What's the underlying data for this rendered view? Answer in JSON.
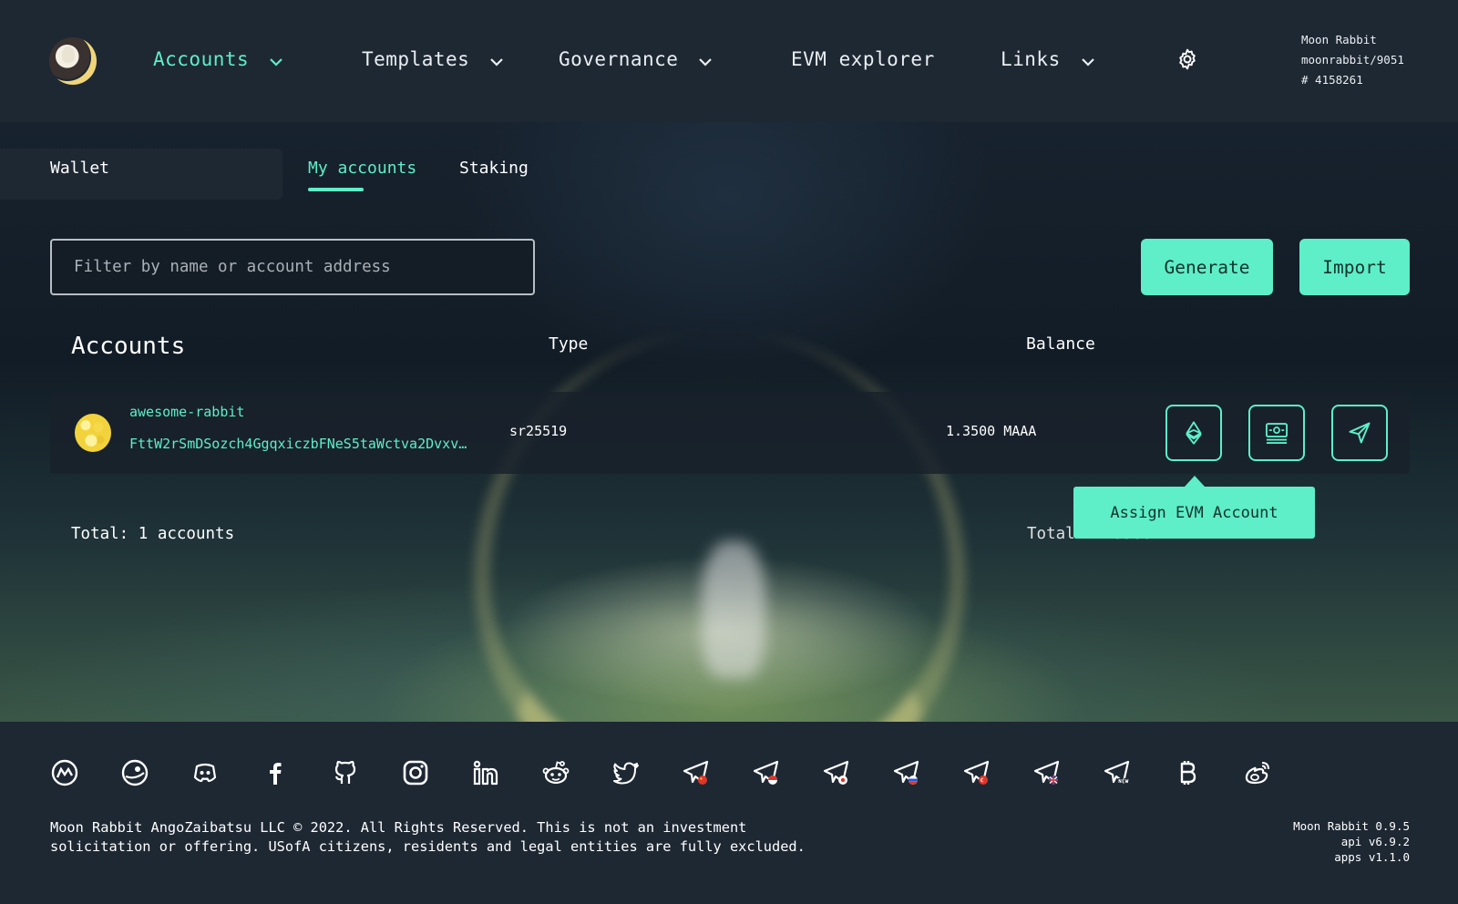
{
  "header": {
    "nav": [
      {
        "label": "Accounts",
        "active": true,
        "has_dropdown": true
      },
      {
        "label": "Templates",
        "active": false,
        "has_dropdown": true
      },
      {
        "label": "Governance",
        "active": false,
        "has_dropdown": true
      },
      {
        "label": "EVM explorer",
        "active": false,
        "has_dropdown": false
      },
      {
        "label": "Links",
        "active": false,
        "has_dropdown": true
      }
    ],
    "settings_icon": "gear-icon",
    "network": {
      "name": "Moon Rabbit",
      "chain": "moonrabbit/9051",
      "block": "# 4158261"
    }
  },
  "subnav": {
    "section": "Wallet",
    "tabs": [
      {
        "label": "My accounts",
        "active": true
      },
      {
        "label": "Staking",
        "active": false
      }
    ]
  },
  "toolbar": {
    "filter_placeholder": "Filter by name or account address",
    "filter_value": "",
    "generate_label": "Generate",
    "import_label": "Import"
  },
  "table": {
    "title": "Accounts",
    "headers": {
      "type": "Type",
      "balance": "Balance"
    },
    "rows": [
      {
        "name": "awesome-rabbit",
        "address": "FttW2rSmDSozch4GgqxiczbFNeS5taWctva2Dvxv…",
        "type": "sr25519",
        "balance": "1.3500 MAAA",
        "actions": [
          "ethereum-icon",
          "dashboard-icon",
          "send-icon"
        ]
      }
    ],
    "total_accounts": "Total: 1 accounts",
    "total_balance": "Total: 1.3500 MAAA"
  },
  "tooltip": {
    "text": "Assign EVM Account"
  },
  "footer": {
    "social_icons": [
      "coinmarketcap-icon",
      "coingecko-icon",
      "discord-icon",
      "facebook-icon",
      "github-icon",
      "instagram-icon",
      "linkedin-icon",
      "reddit-icon",
      "twitter-icon",
      "telegram-cn-icon",
      "telegram-id-icon",
      "telegram-jp-icon",
      "telegram-ru-icon",
      "telegram-tr-icon",
      "telegram-uk-icon",
      "telegram-news-icon",
      "bitcoin-icon",
      "weibo-icon"
    ],
    "legal_line1": "Moon Rabbit AngoZaibatsu LLC © 2022. All Rights Reserved. This is not an investment",
    "legal_line2": "solicitation or offering. USofA citizens, residents and legal entities are fully excluded.",
    "version_app": "Moon Rabbit 0.9.5",
    "version_api": "api v6.9.2",
    "version_apps": "apps v1.1.0"
  },
  "colors": {
    "accent": "#5eeec8",
    "background": "#1e2833",
    "text": "#ffffff"
  }
}
